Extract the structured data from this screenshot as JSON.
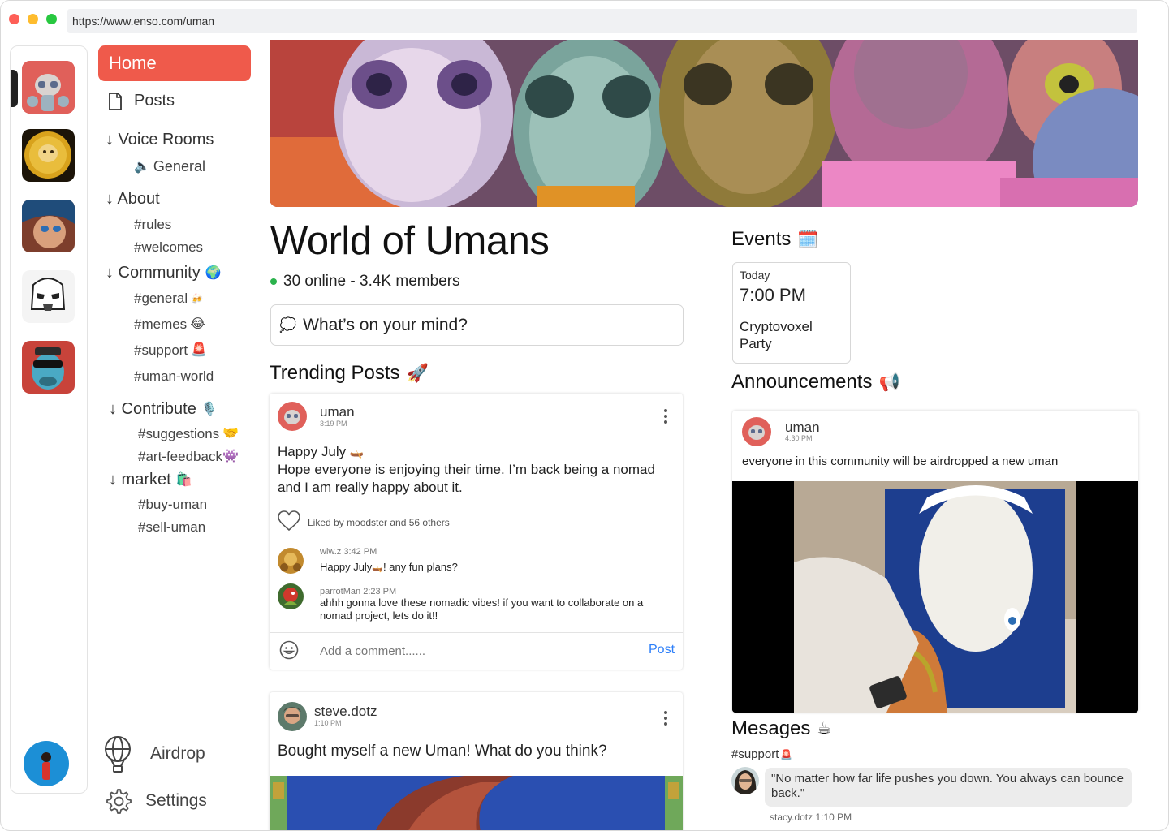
{
  "browser": {
    "url": "https://www.enso.com/uman"
  },
  "rail": {
    "servers": [
      {
        "name": "uman-server",
        "icon": "robot-face-icon"
      },
      {
        "name": "doge-server",
        "icon": "doge-coin-icon"
      },
      {
        "name": "anime-server",
        "icon": "anime-face-icon"
      },
      {
        "name": "trooper-server",
        "icon": "stormtrooper-icon"
      },
      {
        "name": "ape-server",
        "icon": "blue-ape-icon"
      }
    ]
  },
  "nav": {
    "home": "Home",
    "posts": "Posts",
    "voice_rooms": "↓ Voice Rooms",
    "voice_general": "General",
    "about": "↓ About",
    "rules": "#rules",
    "welcomes": "#welcomes",
    "community": "↓ Community",
    "general": "#general",
    "memes": "#memes",
    "support": "#support",
    "uman_world": "#uman-world",
    "contribute": "↓ Contribute",
    "suggestions": "#suggestions",
    "art_feedback": "#art-feedback",
    "market": "↓ market",
    "buy": "#buy-uman",
    "sell": "#sell-uman",
    "airdrop": "Airdrop",
    "settings": "Settings"
  },
  "community": {
    "title": "World of Umans",
    "status": "30 online - 3.4K members",
    "composer_placeholder": "What’s on your mind?"
  },
  "trending": {
    "heading": "Trending Posts",
    "posts": [
      {
        "user": "uman",
        "time": "3:19 PM",
        "title": "Happy July",
        "body": "Hope everyone is enjoying their time. I’m back being a nomad and I am really happy about it.",
        "likes": "Liked by moodster and 56 others",
        "comments": [
          {
            "user": "wiw.z",
            "time": "3:42 PM",
            "text_a": "Happy July",
            "text_b": "! any fun plans?"
          },
          {
            "user": "parrotMan",
            "time": "2:23 PM",
            "text": "ahhh gonna love these nomadic vibes! if you want to collaborate on a nomad project, lets do it!!"
          }
        ],
        "comment_placeholder": "Add a comment......",
        "post_label": "Post"
      },
      {
        "user": "steve.dotz",
        "time": "1:10 PM",
        "body": "Bought myself a new Uman! What do you think?"
      }
    ]
  },
  "events": {
    "heading": "Events",
    "items": [
      {
        "day": "Today",
        "time": "7:00 PM",
        "name": "Cryptovoxel Party"
      }
    ]
  },
  "announcements": {
    "heading": "Announcements",
    "items": [
      {
        "user": "uman",
        "time": "4:30 PM",
        "text": "everyone in this community will be airdropped a new uman"
      }
    ]
  },
  "messages": {
    "heading": "Mesages",
    "channel": "#support",
    "items": [
      {
        "text": "\"No matter how far life pushes you down. You always can bounce back.\"",
        "user": "stacy.dotz",
        "time": "1:10 PM"
      }
    ]
  },
  "colors": {
    "accent": "#ef5a4b",
    "online": "#2bb24c",
    "link": "#2d7ff9"
  }
}
